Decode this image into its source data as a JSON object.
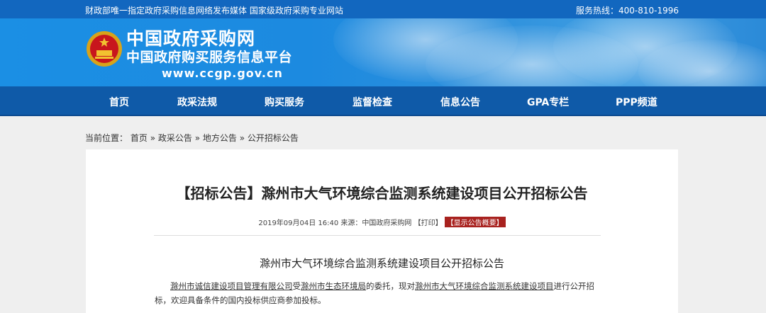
{
  "topbar": {
    "left_text": "财政部唯一指定政府采购信息网络发布媒体  国家级政府采购专业网站",
    "hotline": "服务热线：400-810-1996"
  },
  "header": {
    "logo_title": "中国政府采购网",
    "logo_subtitle": "中国政府购买服务信息平台",
    "logo_url": "www.ccgp.gov.cn"
  },
  "nav": {
    "items": [
      {
        "label": "首页"
      },
      {
        "label": "政采法规"
      },
      {
        "label": "购买服务"
      },
      {
        "label": "监督检查"
      },
      {
        "label": "信息公告"
      },
      {
        "label": "GPA专栏"
      },
      {
        "label": "PPP频道"
      }
    ]
  },
  "breadcrumb": {
    "prefix": "当前位置：",
    "items": [
      "首页",
      "政采公告",
      "地方公告",
      "公开招标公告"
    ],
    "separator": "»"
  },
  "article": {
    "title": "【招标公告】滁州市大气环境综合监测系统建设项目公开招标公告",
    "meta_text": "2019年09月04日 16:40 来源：中国政府采购网 【打印】",
    "summary_tag": "【显示公告概要】",
    "subtitle": "滁州市大气环境综合监测系统建设项目公开招标公告",
    "body": {
      "agent": "滁州市诚信建设项目管理有限公司",
      "text1": "受",
      "client": "滁州市生态环境局",
      "text2": "的委托，现对",
      "project": "滁州市大气环境综合监测系统建设项目",
      "text3": "进行公开招标，欢迎具备条件的国内投标供应商参加投标。"
    }
  },
  "colors": {
    "topbar": "#1267bf",
    "nav": "#0f5aa8",
    "tag": "#a8221f"
  }
}
